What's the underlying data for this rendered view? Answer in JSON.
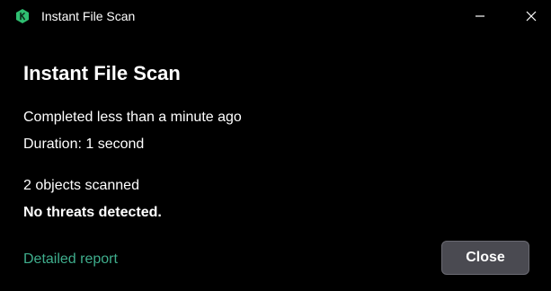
{
  "window": {
    "title": "Instant File Scan",
    "app_icon": "kaspersky-k-icon",
    "minimize_icon": "minimize-icon",
    "close_icon": "close-icon"
  },
  "main": {
    "heading": "Instant File Scan",
    "completed": "Completed less than a minute ago",
    "duration": "Duration: 1 second",
    "objects_scanned": "2 objects scanned",
    "result": "No threats detected."
  },
  "footer": {
    "report_link": "Detailed report",
    "close_label": "Close"
  },
  "colors": {
    "background": "#000000",
    "accent": "#3fae8d",
    "icon_green": "#2fbf71",
    "button_bg": "#4a4a51"
  }
}
